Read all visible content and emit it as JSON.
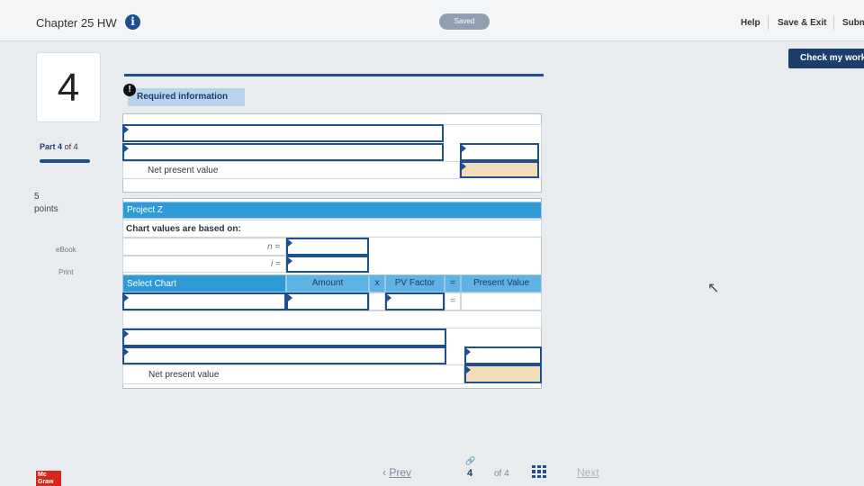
{
  "header": {
    "chapter_title": "Chapter 25 HW",
    "saved_label": "Saved",
    "help_label": "Help",
    "save_exit_label": "Save & Exit",
    "submit_label": "Subm",
    "check_label": "Check my work"
  },
  "sidebar": {
    "question_number": "4",
    "part_prefix": "Part",
    "part_current": "4",
    "part_suffix": "of 4",
    "points_value": "5",
    "points_label": "points",
    "ebook_label": "eBook",
    "print_label": "Print"
  },
  "content": {
    "required_label": "Required information",
    "npv_label_1": "Net present value",
    "project_label": "Project Z",
    "chart_values_label": "Chart values are based on:",
    "n_label": "n =",
    "i_label": "i =",
    "table_headers": {
      "select_chart": "Select Chart",
      "amount": "Amount",
      "times": "x",
      "pv_factor": "PV Factor",
      "equals": "=",
      "present_value": "Present Value"
    },
    "row_equals": "=",
    "npv_label_2": "Net present value"
  },
  "footer": {
    "logo_text": "Mc Graw",
    "prev_label": "Prev",
    "current_page": "4",
    "of_label": "of 4",
    "next_label": "Next"
  },
  "icons": {
    "info": "info-icon",
    "required": "exclamation-icon",
    "link": "link-icon",
    "grid": "grid-icon",
    "cursor": "mouse-cursor-icon"
  },
  "colors": {
    "accent": "#1d4f91",
    "header_blue": "#2e9ad6",
    "check_button": "#1d3d6b",
    "result_cell": "#f3dcb9",
    "logo_red": "#d9261c"
  }
}
